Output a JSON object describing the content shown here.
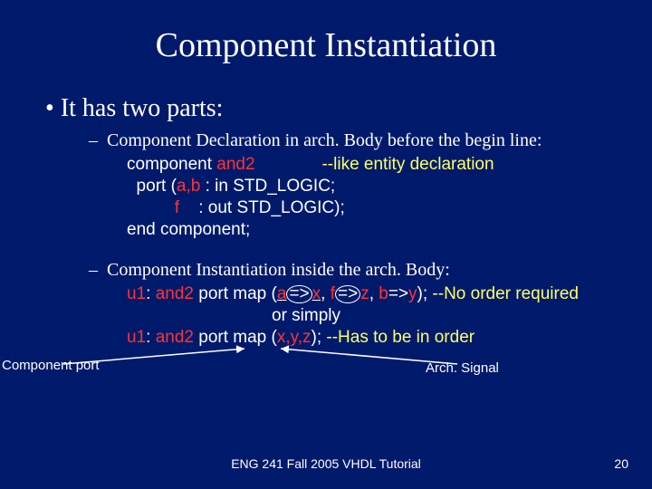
{
  "title": "Component Instantiation",
  "bullet1": "It has two parts:",
  "decl": {
    "heading": "Component Declaration in arch. Body before the begin line:",
    "l1_a": "component ",
    "l1_b": "and2",
    "l1_c": "              ",
    "l1_d": "--like entity declaration",
    "l2_a": "  port (",
    "l2_b": "a,b",
    "l2_c": " : in STD_LOGIC;",
    "l3_a": "          ",
    "l3_b": "f",
    "l3_c": "    : out STD_LOGIC);",
    "l4": "end component;"
  },
  "inst": {
    "heading": "Component Instantiation inside the arch. Body:",
    "l1_a": "u1",
    "l1_b": ": ",
    "l1_c": "and2",
    "l1_d": " port map (",
    "l1_e": "a",
    "l1_f": "=>",
    "l1_g": "x",
    "l1_h": ", ",
    "l1_i": "f",
    "l1_j": "=>",
    "l1_k": "z",
    "l1_l": ", ",
    "l1_m": "b",
    "l1_n": "=>",
    "l1_o": "y",
    "l1_p": "); ",
    "l1_q": "--No order required",
    "l2": "or simply",
    "l3_a": "u1",
    "l3_b": ": ",
    "l3_c": "and2",
    "l3_d": " port map (",
    "l3_e": "x,y,z",
    "l3_f": "); ",
    "l3_g": "--Has to be in order"
  },
  "callouts": {
    "left": "Component port",
    "right": "Arch. Signal"
  },
  "footer": {
    "center": "ENG 241 Fall 2005 VHDL Tutorial",
    "page": "20"
  }
}
